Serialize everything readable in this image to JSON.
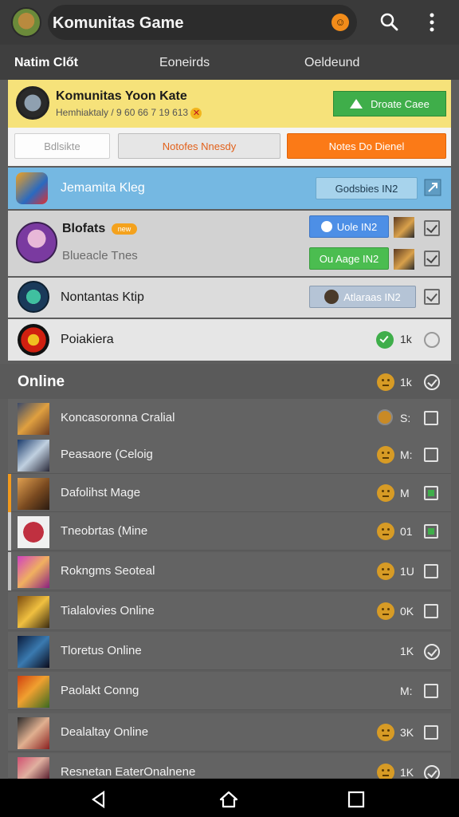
{
  "header": {
    "title": "Komunitas Game",
    "pill_icon": "emoji-face-icon",
    "search_icon": "search-icon",
    "more_icon": "more-vertical-icon"
  },
  "tabs": [
    {
      "label": "Natim Clőt",
      "active": true
    },
    {
      "label": "Eoneirds",
      "active": false
    },
    {
      "label": "Oeldeund",
      "active": false
    }
  ],
  "featured": {
    "title": "Komunitas Yoon Kate",
    "subtitle": "Hemhiaktaly / 9 60 66 7 19 613",
    "button_label": "Droate Caee",
    "button_color": "#3fae4a",
    "bg_color": "#f6e27a"
  },
  "filters": [
    {
      "label": "Bdlsikte"
    },
    {
      "label": "Notofes Nnesdy"
    },
    {
      "label": "Notes Do Dienel"
    }
  ],
  "groups": [
    {
      "name": "Jemamita Kleg",
      "button": "Godsbies IN2"
    },
    {
      "name": "Blofats",
      "badge": "new",
      "subtitle": "Blueacle Tnes",
      "button1": "Uole IN2",
      "button2": "Ou Aage IN2"
    },
    {
      "name": "Nontantas Ktip",
      "button": "Atlaraas IN2"
    },
    {
      "name": "Poiakiera",
      "count": "1k"
    }
  ],
  "online": {
    "title": "Online",
    "count": "1k",
    "rows": [
      {
        "name": "Koncasoronna Cralial",
        "count": "S:",
        "checked": false
      },
      {
        "name": "Peasaore (Celoig",
        "count": "M:",
        "checked": false
      },
      {
        "name": "Dafolihst Mage",
        "count": "M",
        "checked": true
      },
      {
        "name": "Tneobrtas (Mine",
        "count": "01",
        "checked": true
      },
      {
        "name": "Rokngms Seoteal",
        "count": "1U",
        "checked": false
      },
      {
        "name": "Tialalovies Online",
        "count": "0K",
        "checked": false
      },
      {
        "name": "Tloretus Online",
        "count": "1K",
        "checked": true
      },
      {
        "name": "Paolakt Conng",
        "count": "M:",
        "checked": false
      },
      {
        "name": "Dealaltay Online",
        "count": "3K",
        "checked": false
      },
      {
        "name": "Resnetan EaterOnalnene",
        "count": "1K",
        "checked": true
      }
    ]
  },
  "colors": {
    "accent_orange": "#fb7a17",
    "accent_blue": "#75b8e2",
    "green": "#3fae4a"
  }
}
